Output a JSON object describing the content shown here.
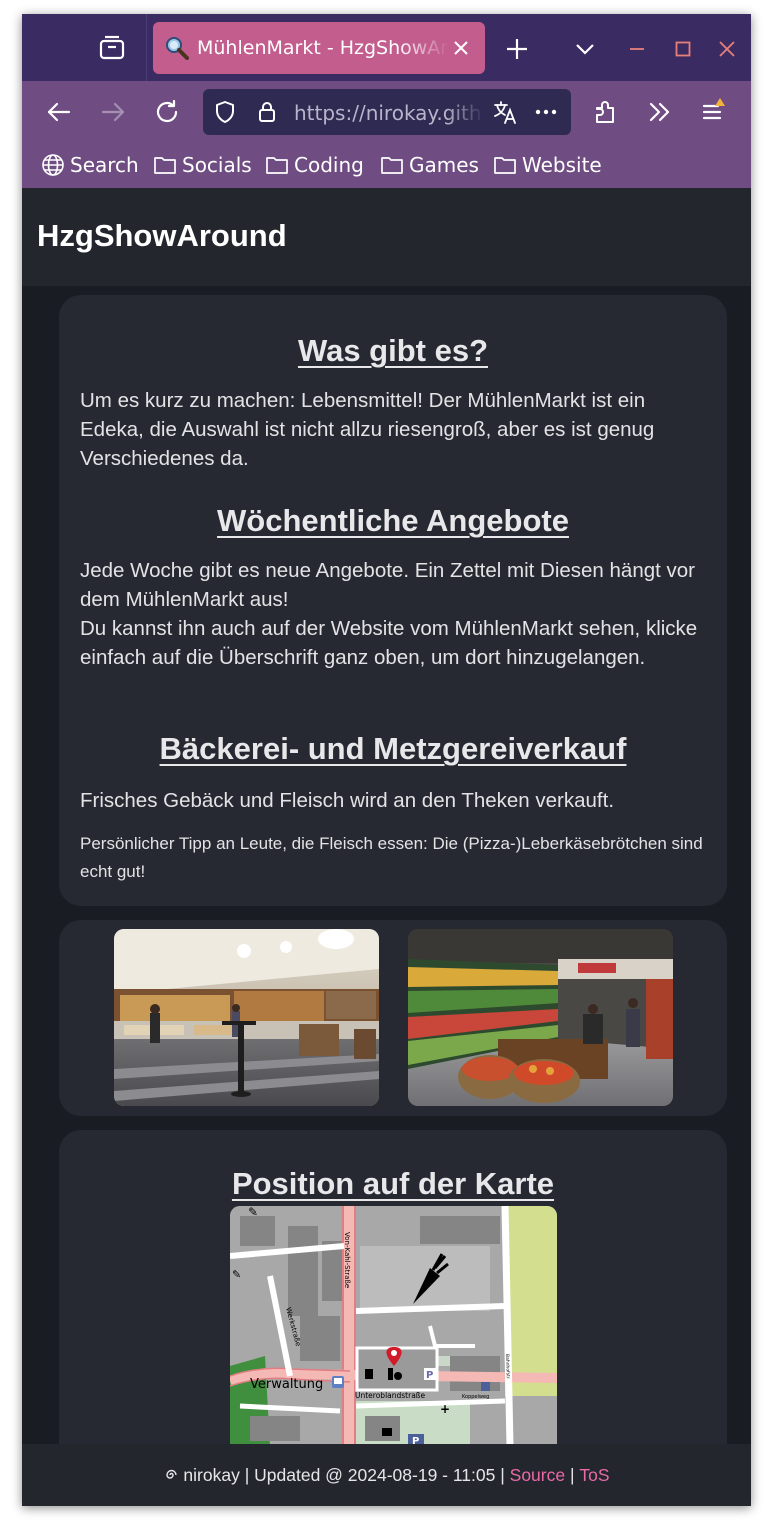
{
  "browser": {
    "tab_title": "MühlenMarkt - HzgShowAround",
    "url": "https://nirokay.github.io/HzgShowAround/",
    "bookmarks": [
      {
        "label": "Search",
        "icon": "globe-icon"
      },
      {
        "label": "Socials",
        "icon": "folder-icon"
      },
      {
        "label": "Coding",
        "icon": "folder-icon"
      },
      {
        "label": "Games",
        "icon": "folder-icon"
      },
      {
        "label": "Website",
        "icon": "folder-icon"
      }
    ],
    "colors": {
      "tabbar": "#3b2b63",
      "toolbar": "#6f4d82",
      "active_tab": "#c25d8d",
      "urlbar": "#2f2a52"
    }
  },
  "site": {
    "title": "HzgShowAround"
  },
  "content": {
    "sections": [
      {
        "heading": "Was gibt es?",
        "text": "Um es kurz zu machen: Lebensmittel! Der MühlenMarkt ist ein Edeka, die Auswahl ist nicht allzu riesengroß, aber es ist genug Verschiedenes da."
      },
      {
        "heading": "Wöchentliche Angebote",
        "text": "Jede Woche gibt es neue Angebote. Ein Zettel mit Diesen hängt vor dem MühlenMarkt aus!",
        "text2": "Du kannst ihn auch auf der Website vom MühlenMarkt sehen, klicke einfach auf die Überschrift ganz oben, um dort hinzugelangen."
      },
      {
        "heading": "Bäckerei- und Metzgereiverkauf",
        "text": "Frisches Gebäck und Fleisch wird an den Theken verkauft.",
        "tip": "Persönlicher Tipp an Leute, die Fleisch essen: Die (Pizza-)Leberkäsebrötchen sind echt gut!"
      }
    ],
    "map": {
      "heading": "Position auf der Karte",
      "labels": {
        "verwaltung": "Verwaltung",
        "street_main": "Unteroblandstraße",
        "street_vertical": "Von-Kahl-Straße",
        "street_werk": "Werkstraße",
        "street_small": "Koppelweg",
        "street_right": "Bahnhofstr."
      }
    }
  },
  "footer": {
    "author": "nirokay",
    "updated": "Updated @ 2024-08-19 - 11:05",
    "source": "Source",
    "tos": "ToS",
    "separator": "|"
  }
}
